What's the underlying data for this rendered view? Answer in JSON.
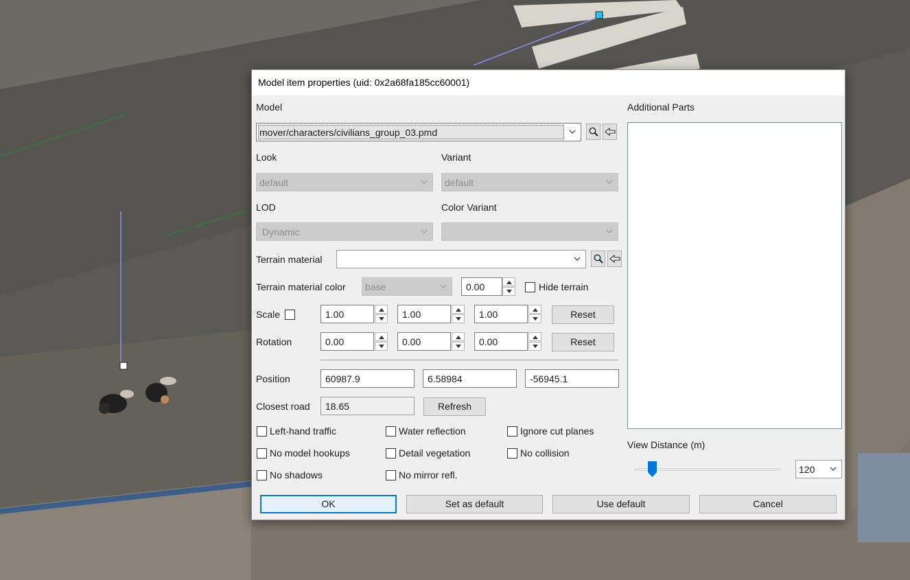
{
  "dialog": {
    "title": "Model item properties (uid: 0x2a68fa185cc60001)",
    "model": {
      "label": "Model",
      "value": "mover/characters/civilians_group_03.pmd"
    },
    "look": {
      "label": "Look",
      "value": "default"
    },
    "variant": {
      "label": "Variant",
      "value": "default"
    },
    "lod": {
      "label": "LOD",
      "value": "Dynamic"
    },
    "color_variant": {
      "label": "Color Variant",
      "value": ""
    },
    "terrain_material": {
      "label": "Terrain material",
      "value": ""
    },
    "terrain_material_color": {
      "label": "Terrain material color",
      "value": "base",
      "amount": "0.00"
    },
    "hide_terrain": {
      "label": "Hide terrain",
      "checked": false
    },
    "scale": {
      "label": "Scale",
      "checked": false,
      "x": "1.00",
      "y": "1.00",
      "z": "1.00",
      "reset_label": "Reset"
    },
    "rotation": {
      "label": "Rotation",
      "x": "0.00",
      "y": "0.00",
      "z": "0.00",
      "reset_label": "Reset"
    },
    "position": {
      "label": "Position",
      "x": "60987.9",
      "y": "6.58984",
      "z": "-56945.1"
    },
    "closest_road": {
      "label": "Closest road",
      "value": "18.65",
      "refresh_label": "Refresh"
    },
    "options": [
      {
        "label": "Left-hand traffic",
        "checked": false
      },
      {
        "label": "Water reflection",
        "checked": false
      },
      {
        "label": "Ignore cut planes",
        "checked": false
      },
      {
        "label": "No model hookups",
        "checked": false
      },
      {
        "label": "Detail vegetation",
        "checked": false
      },
      {
        "label": "No collision",
        "checked": false
      },
      {
        "label": "No shadows",
        "checked": false
      },
      {
        "label": "No mirror refl.",
        "checked": false
      }
    ],
    "additional_parts": {
      "label": "Additional Parts",
      "items": []
    },
    "view_distance": {
      "label": "View Distance (m)",
      "value": "120",
      "slider_fraction": 0.1
    },
    "buttons": {
      "ok": "OK",
      "set_default": "Set as default",
      "use_default": "Use default",
      "cancel": "Cancel"
    }
  },
  "colors": {
    "accent": "#0078d7",
    "gizmo": "#8c8cf2",
    "gizmo_handle": "#27c4f5"
  }
}
